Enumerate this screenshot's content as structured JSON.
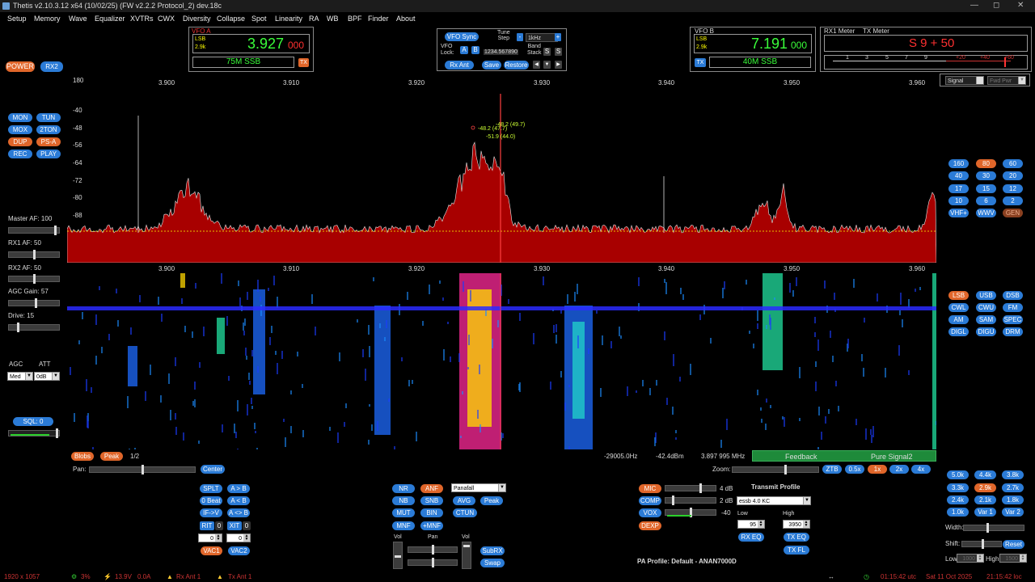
{
  "window": {
    "title": "Thetis v2.10.3.12 x64 (10/02/25) (FW v2.2.2 Protocol_2) dev.18c"
  },
  "menu": [
    "Setup",
    "Memory",
    "Wave",
    "Equalizer",
    "XVTRs",
    "CWX",
    "Diversity",
    "Collapse",
    "Spot",
    "Linearity",
    "RA",
    "WB",
    "BPF",
    "Finder",
    "About"
  ],
  "left": {
    "power": "POWER",
    "rx2": "RX2",
    "buttons": [
      "MON",
      "TUN",
      "MOX",
      "2TON",
      "DUP",
      "PS-A",
      "REC",
      "PLAY"
    ],
    "master_af_label": "Master AF:",
    "master_af": "100",
    "rx1_af_label": "RX1 AF:",
    "rx1_af": "50",
    "rx2_af_label": "RX2 AF:",
    "rx2_af": "50",
    "agc_gain_label": "AGC Gain:",
    "agc_gain": "57",
    "drive_label": "Drive:",
    "drive": "15",
    "agc_label": "AGC",
    "att_label": "ATT",
    "agc_value": "Med",
    "att_value": "0dB",
    "sql": "SQL: 0"
  },
  "vfo_a": {
    "label": "VFO A",
    "mode": "LSB",
    "bw": "2.9k",
    "freq_main": "3.927",
    "freq_sub": "000",
    "band": "75M SSB",
    "tx": "TX"
  },
  "vfo_center": {
    "sync": "VFO Sync",
    "tune_step_label": "Tune\nStep",
    "tune_step": "1kHz",
    "vfo_lock_label": "VFO\nLock:",
    "a": "A",
    "b": "B",
    "lock_value": "1234.567890",
    "band_stack_label": "Band\nStack",
    "s1": "S",
    "s2": "S",
    "rx_ant": "Rx Ant",
    "save": "Save",
    "restore": "Restore"
  },
  "vfo_b": {
    "label": "VFO B",
    "mode": "LSB",
    "bw": "2.9k",
    "freq_main": "7.191",
    "freq_sub": "000",
    "band": "40M SSB",
    "tx": "TX"
  },
  "meter": {
    "rx1": "RX1 Meter",
    "tx": "TX Meter",
    "reading": "S 9 + 50",
    "scale": [
      "1",
      "3",
      "5",
      "7",
      "9",
      "+20",
      "+40",
      "+60"
    ],
    "sel1": "Signal",
    "sel2": "Fwd Pwr"
  },
  "display": {
    "top_left_num": "180",
    "freq_labels": [
      "3.900",
      "3.910",
      "3.920",
      "3.930",
      "3.940",
      "3.950",
      "3.960"
    ],
    "db_labels": [
      "-40",
      "-48",
      "-56",
      "-64",
      "-72",
      "-80",
      "-88"
    ],
    "peak_labels": [
      "-48.2 (47.7)",
      "-48.2 (49.7)",
      "-51.9 (44.0)"
    ],
    "wf_info": [
      "-29005.0Hz",
      "-42.4dBm",
      "3.897 995 MHz"
    ],
    "blobs": "Blobs",
    "peak": "Peak",
    "page": "1/2",
    "feedback": "Feedback",
    "pure_signal": "Pure Signal2"
  },
  "pan_zoom": {
    "pan": "Pan:",
    "center": "Center",
    "zoom": "Zoom:",
    "ztb": "ZTB",
    "zooms": [
      "0.5x",
      "1x",
      "2x",
      "4x"
    ]
  },
  "bands": [
    "160",
    "80",
    "60",
    "40",
    "30",
    "20",
    "17",
    "15",
    "12",
    "10",
    "6",
    "2",
    "VHF+",
    "WWV",
    "GEN"
  ],
  "modes": [
    "LSB",
    "USB",
    "DSB",
    "CWL",
    "CWU",
    "FM",
    "AM",
    "SAM",
    "SPEC",
    "DIGL",
    "DIGU",
    "DRM"
  ],
  "filters": [
    "5.0k",
    "4.4k",
    "3.8k",
    "3.3k",
    "2.9k",
    "2.7k",
    "2.4k",
    "2.1k",
    "1.8k",
    "1.0k",
    "Var 1",
    "Var 2"
  ],
  "filter_ctrl": {
    "width": "Width:",
    "shift": "Shift:",
    "reset": "Reset",
    "low": "Low",
    "high": "High",
    "low_val": "1000",
    "high_val": "1500"
  },
  "split": {
    "splt": "SPLT",
    "atob": "A > B",
    "zbeat": "0 Beat",
    "btoa": "A < B",
    "ifv": "IF->V",
    "swap": "A <> B",
    "rit": "RIT",
    "rit_val": "0",
    "xit": "XIT",
    "xit_val": "0",
    "rit_num": "0",
    "xit_num": "0",
    "vac1": "VAC1",
    "vac2": "VAC2"
  },
  "dsp": {
    "nr": "NR",
    "anf": "ANF",
    "display_mode": "Panafall",
    "nb": "NB",
    "snb": "SNB",
    "avg": "AVG",
    "peak": "Peak",
    "mut": "MUT",
    "bin": "BIN",
    "ctun": "CTUN",
    "mnf": "MNF",
    "pmnf": "+MNF",
    "vol": "Vol",
    "pan": "Pan",
    "vol2": "Vol",
    "subrx": "SubRX",
    "swap": "Swap"
  },
  "tx": {
    "mic": "MIC",
    "mic_val": "4 dB",
    "comp": "COMP",
    "comp_val": "2 dB",
    "vox": "VOX",
    "vox_val": "-40",
    "dexp": "DEXP",
    "profile_label": "Transmit Profile",
    "profile": "essb 4.0 KC",
    "low": "Low",
    "high": "High",
    "low_val": "95",
    "high_val": "3950",
    "rx_eq": "RX EQ",
    "tx_eq": "TX EQ",
    "tx_fl": "TX FL",
    "pa_profile": "PA Profile: Default - ANAN7000D"
  },
  "status": {
    "res": "1920 x 1057",
    "cpu": "3%",
    "volt": "13.9V",
    "amp": "0.0A",
    "rx_ant": "Rx Ant 1",
    "tx_ant": "Tx Ant 1",
    "utc": "01:15:42 utc",
    "date": "Sat 11 Oct 2025",
    "local": "21:15:42 loc"
  }
}
